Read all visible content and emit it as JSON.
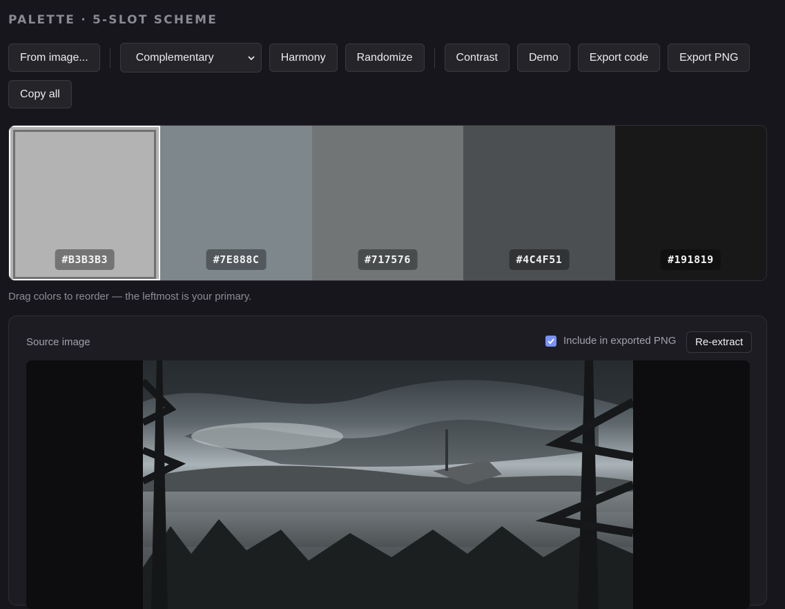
{
  "header": {
    "title": "PALETTE · 5-SLOT SCHEME"
  },
  "toolbar": {
    "from_image": "From image...",
    "scheme_select": {
      "value": "Complementary"
    },
    "harmony": "Harmony",
    "randomize": "Randomize",
    "contrast": "Contrast",
    "demo": "Demo",
    "export_code": "Export code",
    "export_png": "Export PNG",
    "copy_all": "Copy all"
  },
  "palette": {
    "swatches": [
      {
        "hex": "#B3B3B3",
        "color": "#B3B3B3"
      },
      {
        "hex": "#7E888C",
        "color": "#7E888C"
      },
      {
        "hex": "#717576",
        "color": "#717576"
      },
      {
        "hex": "#4C4F51",
        "color": "#4C4F51"
      },
      {
        "hex": "#191819",
        "color": "#191819"
      }
    ],
    "hint": "Drag colors to reorder — the leftmost is your primary."
  },
  "source": {
    "label": "Source image",
    "include_label": "Include in exported PNG",
    "include_checked": true,
    "reextract": "Re-extract"
  },
  "colors": {
    "accent": "#7A92FF",
    "background": "#17161C",
    "panel": "#1D1C22"
  }
}
